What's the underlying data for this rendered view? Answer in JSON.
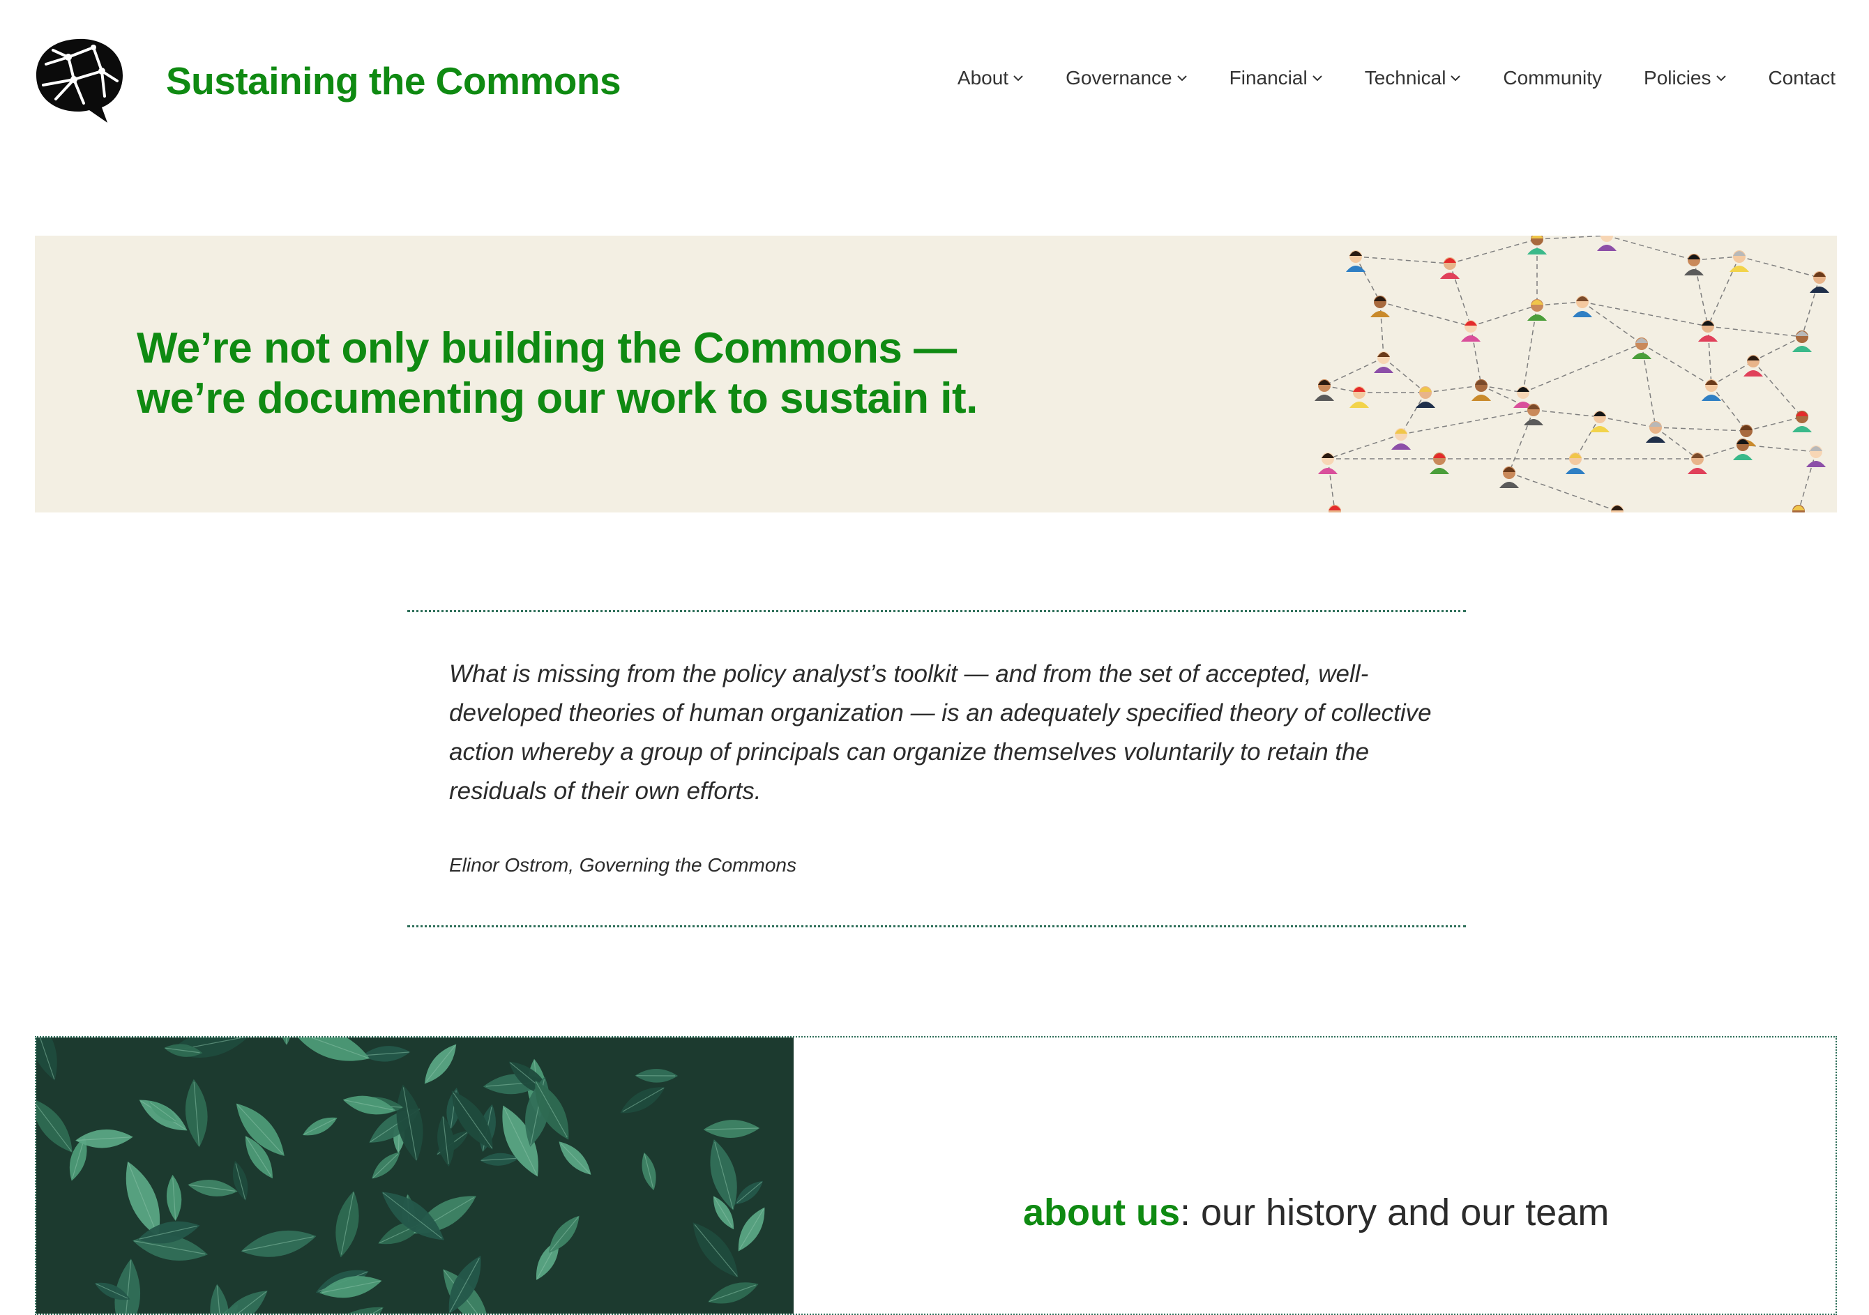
{
  "site": {
    "title": "Sustaining the Commons",
    "logo_icon": "speech-bubble-network-icon",
    "brand_color": "#0f8a12"
  },
  "nav": {
    "items": [
      {
        "label": "About",
        "has_dropdown": true
      },
      {
        "label": "Governance",
        "has_dropdown": true
      },
      {
        "label": "Financial",
        "has_dropdown": true
      },
      {
        "label": "Technical",
        "has_dropdown": true
      },
      {
        "label": "Community",
        "has_dropdown": false
      },
      {
        "label": "Policies",
        "has_dropdown": true
      },
      {
        "label": "Contact",
        "has_dropdown": false
      }
    ]
  },
  "hero": {
    "line1": "We’re not only building the Commons —",
    "line2": "we’re documenting our work to sustain it.",
    "background": "#f3efe3"
  },
  "quote": {
    "text": "What is missing from the policy analyst’s toolkit — and from the set of accepted, well-developed theories of human organization — is an adequately specified theory of collective action whereby a group of principals can organize themselves voluntarily to retain the residuals of their own efforts.",
    "citation": "Elinor Ostrom, Governing the Commons"
  },
  "about": {
    "link_label": "about us",
    "rest": ": our history and our team"
  }
}
